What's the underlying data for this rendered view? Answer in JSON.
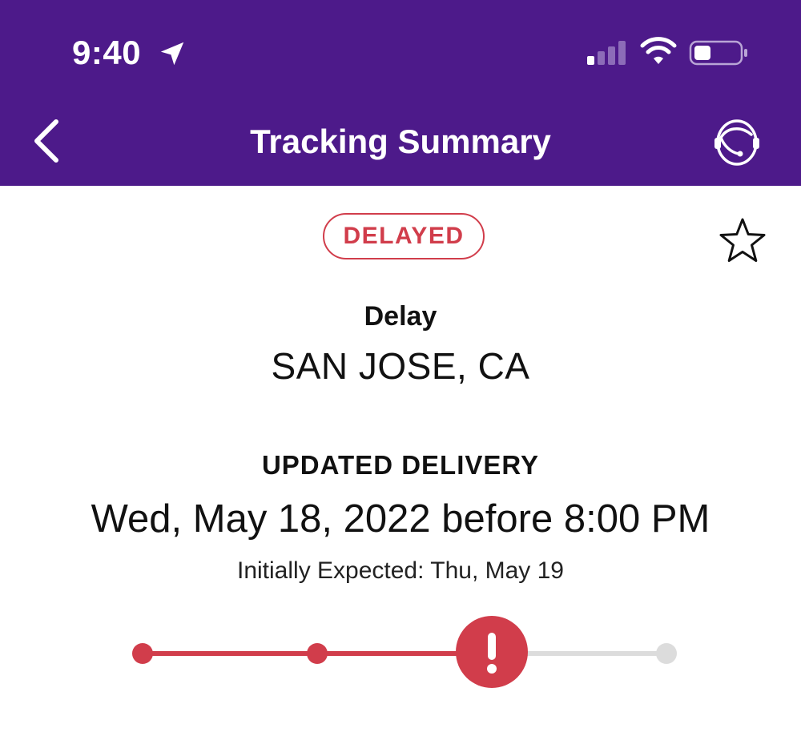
{
  "status_bar": {
    "time": "9:40"
  },
  "nav": {
    "title": "Tracking Summary",
    "back_icon": "chevron-left-icon",
    "support_icon": "headset-icon"
  },
  "tracking": {
    "status_badge": "DELAYED",
    "event_label": "Delay",
    "event_location": "SAN JOSE, CA",
    "delivery_label": "UPDATED DELIVERY",
    "delivery_date": "Wed, May 18, 2022 before 8:00 PM",
    "initially_expected": "Initially Expected: Thu, May 19",
    "progress": {
      "total_steps": 4,
      "current_step": 3,
      "current_state": "alert"
    }
  },
  "colors": {
    "header_bg": "#4d1a8a",
    "accent_red": "#d13d4b",
    "inactive_gray": "#dcdcdc"
  }
}
